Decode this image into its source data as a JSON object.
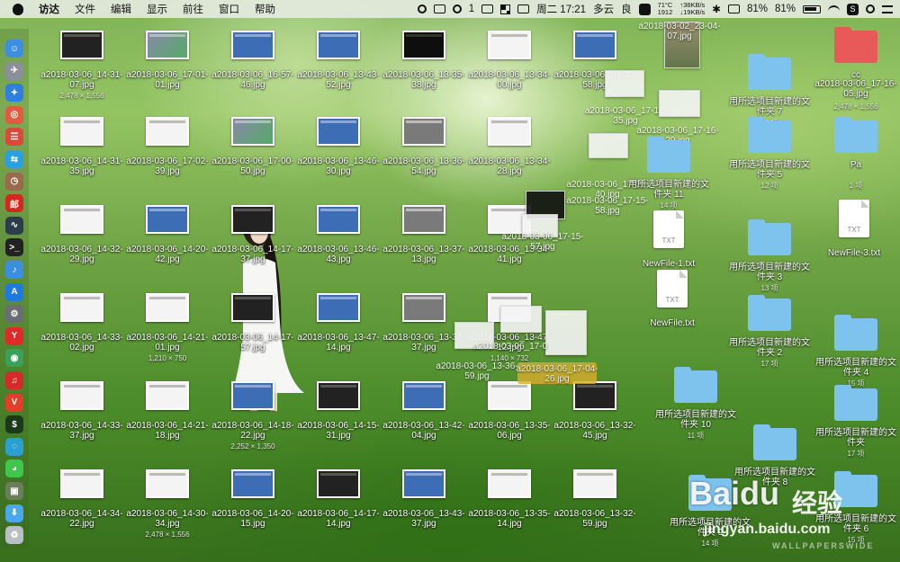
{
  "menubar": {
    "app": "访达",
    "menus": [
      "文件",
      "编辑",
      "显示",
      "前往",
      "窗口",
      "帮助"
    ],
    "badge": "1",
    "datetime": "周二 17:21",
    "weather": "多云",
    "aqi": "良",
    "temp": "71°C",
    "fan": "1912",
    "upload": "↑38KB/s",
    "download": "↓19KB/s",
    "cpu": "81%",
    "battery": "81%"
  },
  "dock": [
    {
      "name": "finder",
      "color": "#3f8fe0",
      "glyph": "☺"
    },
    {
      "name": "launchpad",
      "color": "#8a8f99",
      "glyph": "✈"
    },
    {
      "name": "safari",
      "color": "#2f7fe0",
      "glyph": "✦"
    },
    {
      "name": "maps",
      "color": "#e05c40",
      "glyph": "◎"
    },
    {
      "name": "book",
      "color": "#d94a3a",
      "glyph": "☰"
    },
    {
      "name": "folder-sync",
      "color": "#2aa0e0",
      "glyph": "⇆"
    },
    {
      "name": "clock",
      "color": "#9b6a4a",
      "glyph": "◷"
    },
    {
      "name": "mail",
      "color": "#d4281e",
      "glyph": "邮"
    },
    {
      "name": "activity",
      "color": "#2b3d4a",
      "glyph": "∿"
    },
    {
      "name": "terminal",
      "color": "#222",
      "glyph": ">_"
    },
    {
      "name": "voice",
      "color": "#3a8fe0",
      "glyph": "♪"
    },
    {
      "name": "app-store",
      "color": "#1e7ae0",
      "glyph": "A"
    },
    {
      "name": "preferences",
      "color": "#6a6e73",
      "glyph": "⚙"
    },
    {
      "name": "yandex",
      "color": "#e02a2a",
      "glyph": "Y"
    },
    {
      "name": "chrome",
      "color": "#3aa05a",
      "glyph": "◉"
    },
    {
      "name": "netease",
      "color": "#d62a2a",
      "glyph": "♫"
    },
    {
      "name": "vivaldi",
      "color": "#e0402a",
      "glyph": "V"
    },
    {
      "name": "dev",
      "color": "#1a3a1a",
      "glyph": "$"
    },
    {
      "name": "chat",
      "color": "#2a9fd0",
      "glyph": "◌"
    },
    {
      "name": "wechat",
      "color": "#3ec74a",
      "glyph": "◕"
    },
    {
      "name": "photos",
      "color": "#6a7e5a",
      "glyph": "▣"
    },
    {
      "name": "downloads",
      "color": "#4aa8e8",
      "glyph": "⬇"
    },
    {
      "name": "trash",
      "color": "#b9c0c4",
      "glyph": "♻"
    }
  ],
  "files": [
    {
      "name": "a2018-03-06_14-31-07.jpg",
      "sub": "2,478 × 1,556",
      "style": "t-dark"
    },
    {
      "name": "a2018-03-06_17-01-01.jpg",
      "style": "t-photo"
    },
    {
      "name": "a2018-03-06_16-57-46.jpg",
      "style": "t-blue"
    },
    {
      "name": "a2018-03-06_13-43-52.jpg",
      "style": "t-blue"
    },
    {
      "name": "a2018-03-06_13-35-38.jpg",
      "style": "t-term"
    },
    {
      "name": "a2018-03-06_13-34-00.jpg",
      "style": "t-white"
    },
    {
      "name": "a2018-03-06_13-30-58.jpg",
      "style": "t-blue"
    },
    {
      "name": "a2018-03-06_14-31-35.jpg",
      "style": "t-white"
    },
    {
      "name": "a2018-03-06_17-02-39.jpg",
      "style": "t-white"
    },
    {
      "name": "a2018-03-06_17-00-50.jpg",
      "style": "t-photo"
    },
    {
      "name": "a2018-03-06_13-46-30.jpg",
      "style": "t-blue"
    },
    {
      "name": "a2018-03-06_13-36-54.jpg",
      "style": "t-gray"
    },
    {
      "name": "a2018-03-06_13-34-28.jpg",
      "style": "t-white"
    },
    {
      "name": "a2018-03-06_14-32-29.jpg",
      "style": "t-white"
    },
    {
      "name": "a2018-03-06_14-20-42.jpg",
      "style": "t-blue"
    },
    {
      "name": "a2018-03-06_14-17-37.jpg",
      "style": "t-dark"
    },
    {
      "name": "a2018-03-06_13-46-43.jpg",
      "style": "t-blue"
    },
    {
      "name": "a2018-03-06_13-37-13.jpg",
      "style": "t-gray"
    },
    {
      "name": "a2018-03-06_13-34-41.jpg",
      "style": "t-white"
    },
    {
      "name": "a2018-03-06_14-33-02.jpg",
      "style": "t-white"
    },
    {
      "name": "a2018-03-06_14-21-01.jpg",
      "sub": "1,210 × 750",
      "style": "t-white"
    },
    {
      "name": "a2018-03-06_14-17-57.jpg",
      "style": "t-dark"
    },
    {
      "name": "a2018-03-06_13-47-14.jpg",
      "style": "t-blue"
    },
    {
      "name": "a2018-03-06_13-37-37.jpg",
      "style": "t-gray"
    },
    {
      "name": "a2018-03-06_14-33-37.jpg",
      "style": "t-white"
    },
    {
      "name": "a2018-03-06_14-21-18.jpg",
      "style": "t-white"
    },
    {
      "name": "a2018-03-06_14-18-22.jpg",
      "sub": "2,252 × 1,350",
      "style": "t-blue"
    },
    {
      "name": "a2018-03-06_14-15-31.jpg",
      "style": "t-dark"
    },
    {
      "name": "a2018-03-06_13-42-04.jpg",
      "style": "t-blue"
    },
    {
      "name": "a2018-03-06_13-35-06.jpg",
      "style": "t-white"
    },
    {
      "name": "a2018-03-06_13-32-45.jpg",
      "style": "t-dark"
    },
    {
      "name": "a2018-03-06_14-34-22.jpg",
      "style": "t-white"
    },
    {
      "name": "a2018-03-06_14-30-34.jpg",
      "sub": "2,478 × 1,556",
      "style": "t-white"
    },
    {
      "name": "a2018-03-06_14-20-15.jpg",
      "style": "t-blue"
    },
    {
      "name": "a2018-03-06_14-17-14.jpg",
      "style": "t-dark"
    },
    {
      "name": "a2018-03-06_13-43-37.jpg",
      "style": "t-blue"
    },
    {
      "name": "a2018-03-06_13-35-14.jpg",
      "style": "t-white"
    },
    {
      "name": "a2018-03-06_13-32-59.jpg",
      "style": "t-white"
    },
    {
      "name": "a2018-03-06_13-47-12.jpg",
      "sub": "1,140 × 732",
      "style": "t-white"
    }
  ],
  "overlap_labels": [
    "a2018-03-02_23-04-07.jpg",
    "a2018-03-06_17-11-35.jpg",
    "a2018-03-06_17-16-29.jpg",
    "a2018-03-06_17-12-40.jpg",
    "a2018-03-06_17-15-58.jpg",
    "a2018-03-06_17-15-57.jpg",
    "a2018-03-06_17-04-26.jpg",
    "a2018-03-06_13-36-59.jpg",
    "a2018-03-06_17-0"
  ],
  "folders": [
    {
      "name": "用所选项目新建的文件夹 7",
      "count": "16 项"
    },
    {
      "name": "cc",
      "count": "",
      "sub": "a2018-03-06_17-16-05.jpg",
      "sub2": "2,478 × 1,556"
    },
    {
      "name": "用所选项目新建的文件夹 5",
      "count": "12 项"
    },
    {
      "name": "Pa",
      "count": "1 项"
    },
    {
      "name": "用所选项目新建的文件夹 11",
      "count": "14 项"
    },
    {
      "name": "用所选项目新建的文件夹 3",
      "count": "13 项"
    },
    {
      "name": "用所选项目新建的文件夹 2",
      "count": "17 项"
    },
    {
      "name": "用所选项目新建的文件夹 4",
      "count": "15 项"
    },
    {
      "name": "用所选项目新建的文件夹 10",
      "count": "11 项"
    },
    {
      "name": "用所选项目新建的文件夹",
      "count": "17 项"
    },
    {
      "name": "用所选项目新建的文件夹 8",
      "count": ""
    },
    {
      "name": "用所选项目新建的文件夹 9",
      "count": "14 项"
    },
    {
      "name": "用所选项目新建的文件夹 6",
      "count": "15 项"
    }
  ],
  "docs": [
    {
      "name": "NewFile-1.txt",
      "ext": "TXT"
    },
    {
      "name": "NewFile.txt",
      "ext": "TXT"
    },
    {
      "name": "NewFile-3.txt",
      "ext": "TXT"
    }
  ],
  "watermark": {
    "brand": "Bai",
    "paw": "du",
    "cn": "经验",
    "url": "jingyan.baidu.com",
    "bg": "WALLPAPERSWIDE"
  }
}
